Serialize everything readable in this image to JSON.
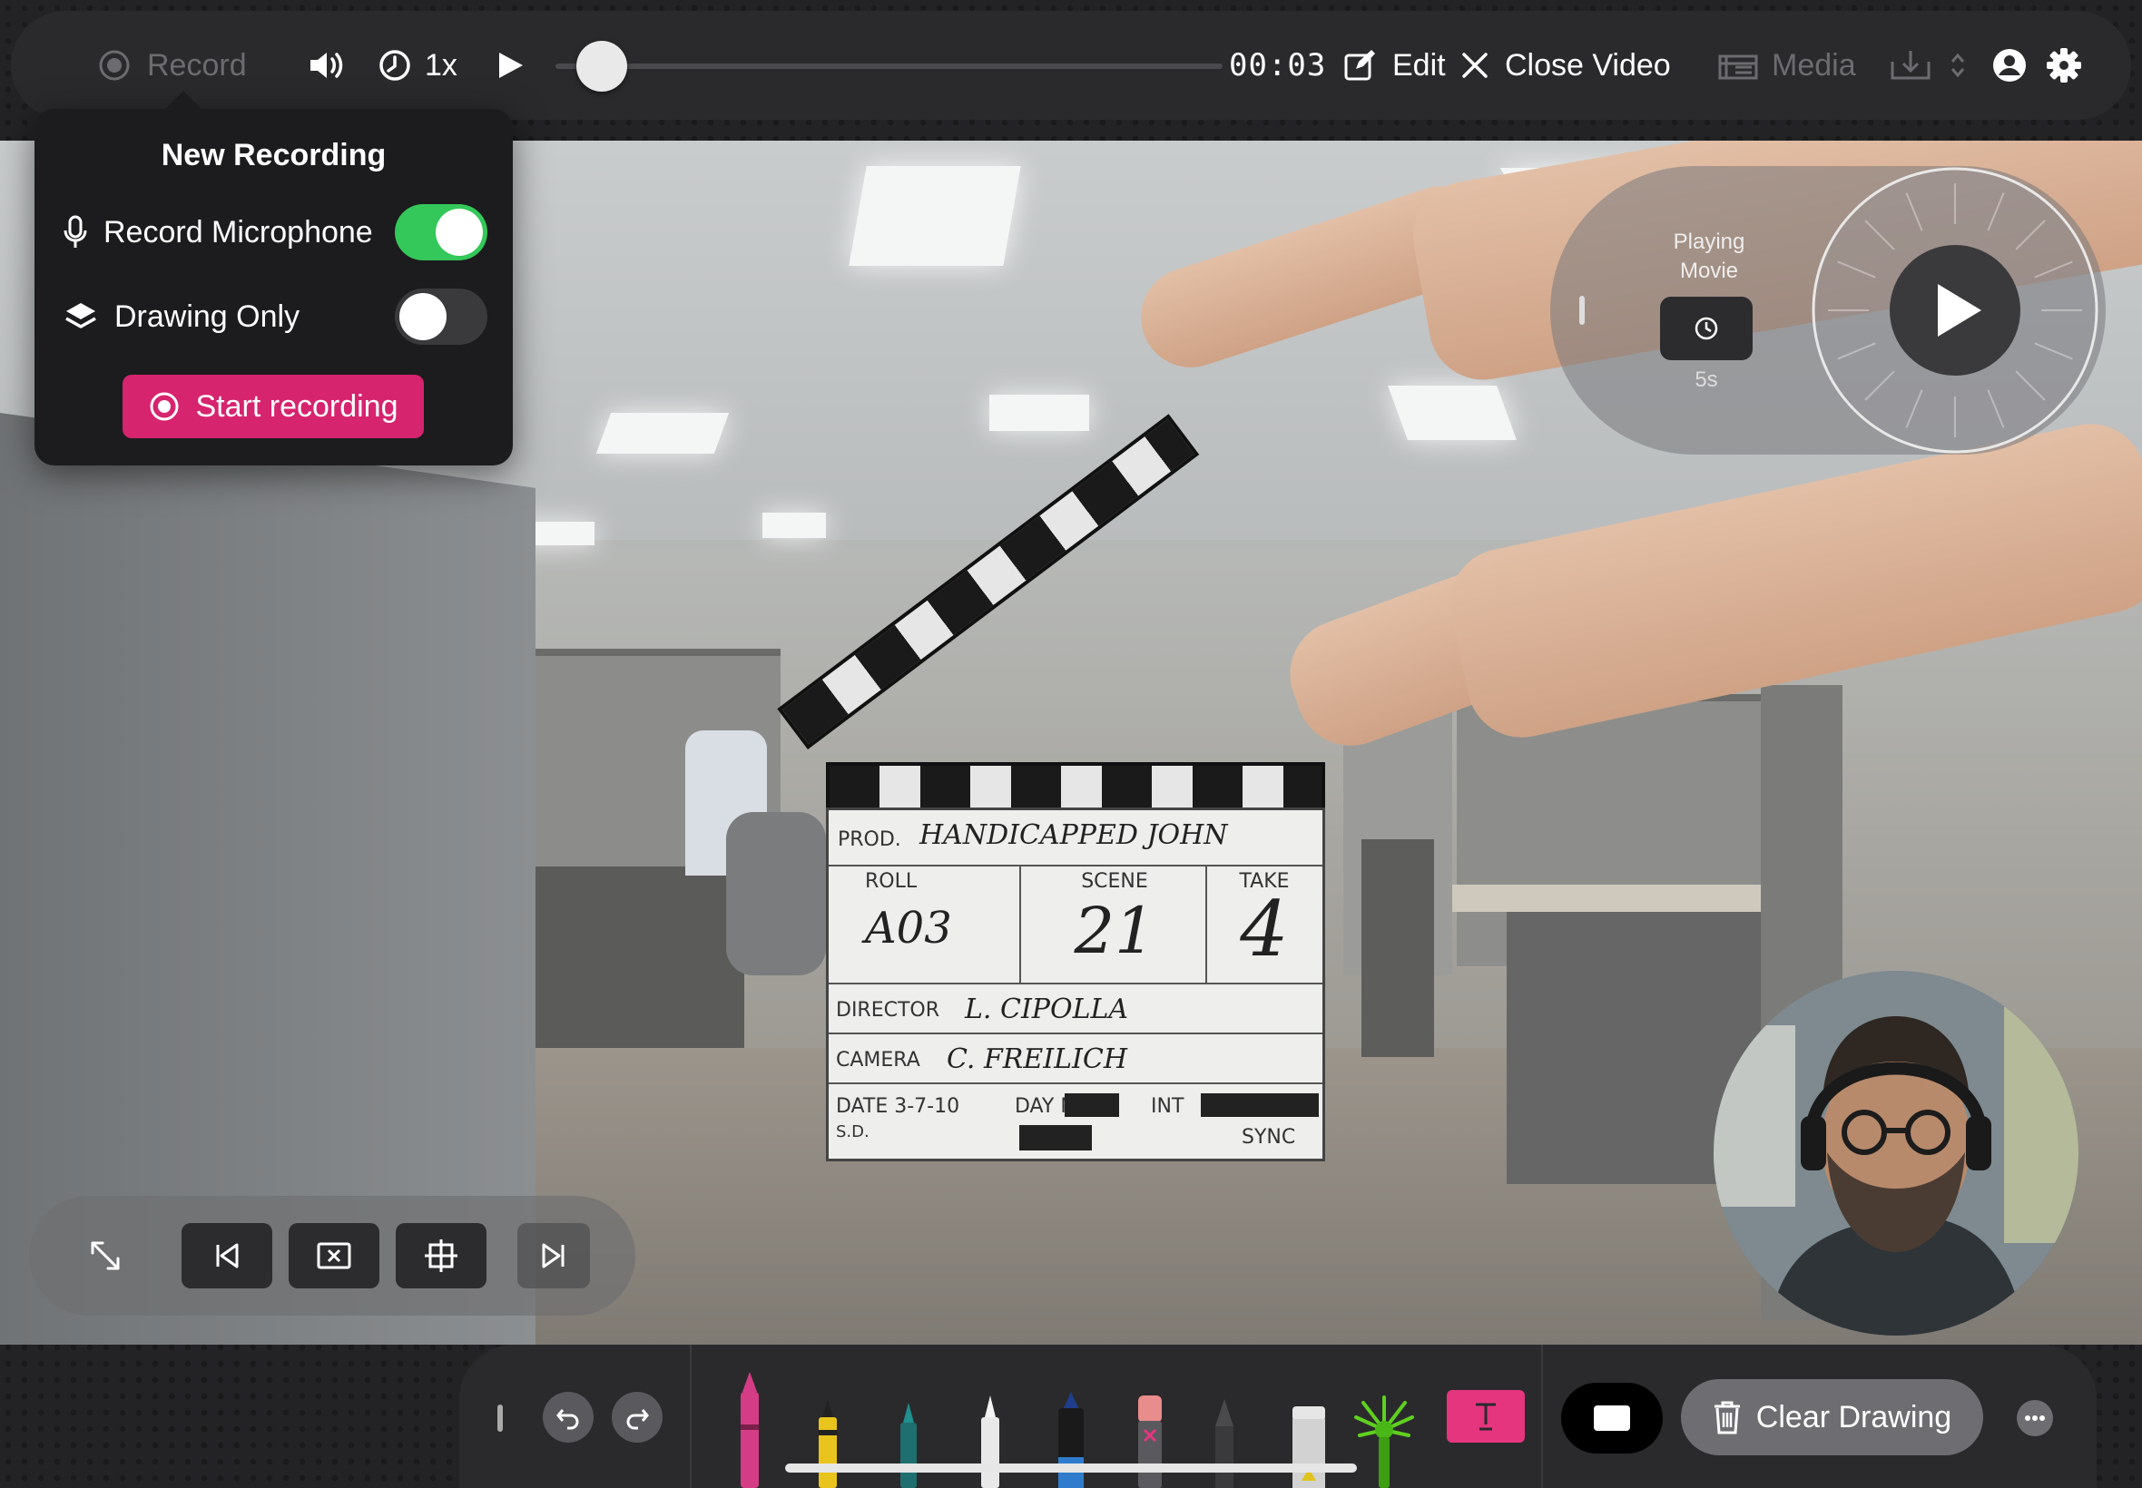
{
  "topbar": {
    "record_label": "Record",
    "speed_label": "1x",
    "time": "00:03",
    "edit_label": "Edit",
    "close_label": "Close Video",
    "media_label": "Media",
    "progress_fraction": 0.04
  },
  "popover": {
    "title": "New Recording",
    "microphone_label": "Record Microphone",
    "microphone_on": true,
    "drawing_only_label": "Drawing Only",
    "drawing_only_on": false,
    "start_label": "Start recording"
  },
  "play_widget": {
    "status_line1": "Playing",
    "status_line2": "Movie",
    "delay": "5s"
  },
  "slate": {
    "prod_label": "PROD.",
    "prod_value": "HANDICAPPED JOHN",
    "roll_label": "ROLL",
    "roll_value": "A03",
    "scene_label": "SCENE",
    "scene_value": "21",
    "take_label": "TAKE",
    "take_value": "4",
    "director_label": "DIRECTOR",
    "director_value": "L. CIPOLLA",
    "camera_label": "CAMERA",
    "camera_value": "C. FREILICH",
    "date_label": "DATE 3-7-10",
    "day_label": "DAY N",
    "int_label": "INT",
    "sync_label": "SYNC",
    "sd_label": "S.D."
  },
  "bottombar": {
    "clear_label": "Clear Drawing",
    "tools": [
      "pink-marker",
      "yellow-highlighter",
      "teal-pen",
      "white-pen",
      "blue-marker",
      "eraser",
      "pencil",
      "glue-stick",
      "green-brush"
    ]
  },
  "colors": {
    "accent_record": "#d6246e",
    "toggle_on": "#34c759",
    "text_tool": "#e5357f"
  }
}
